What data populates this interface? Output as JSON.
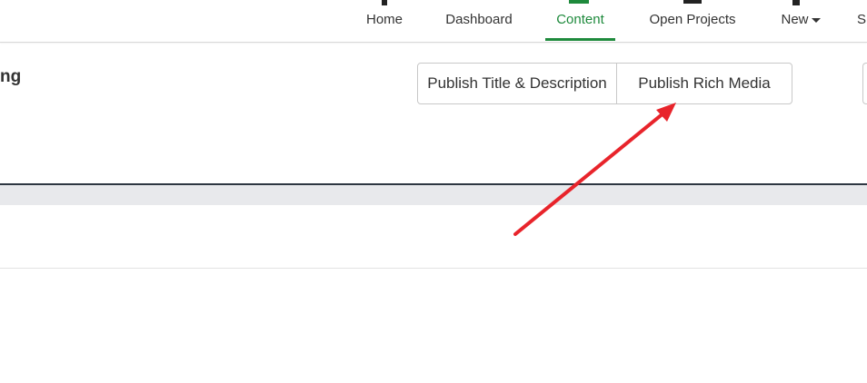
{
  "nav": {
    "items": [
      {
        "label": "Home"
      },
      {
        "label": "Dashboard"
      },
      {
        "label": "Content"
      },
      {
        "label": "Open Projects"
      },
      {
        "label": "New"
      },
      {
        "label": "S"
      }
    ],
    "active": "Content",
    "active_color": "#1e8a3c",
    "new_has_caret": true
  },
  "page": {
    "title_fragment": "ng"
  },
  "toolbar": {
    "publish_title_desc_label": "Publish Title & Description",
    "publish_rich_media_label": "Publish Rich Media"
  },
  "annotation": {
    "arrow_color": "#e8242b",
    "points_to": "Publish Rich Media"
  }
}
